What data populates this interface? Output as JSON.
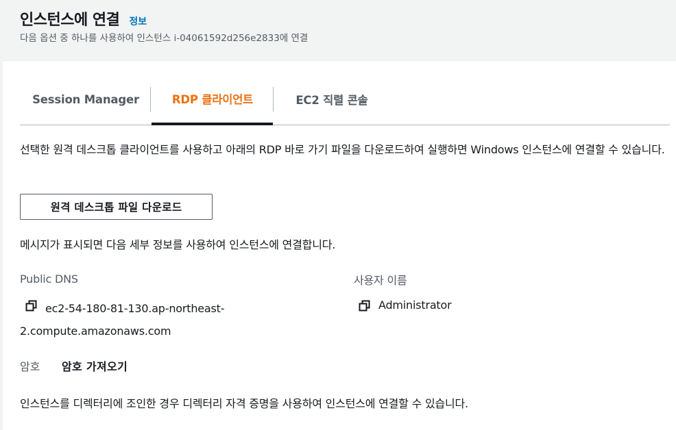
{
  "header": {
    "title": "인스턴스에 연결",
    "info_link": "정보",
    "subtitle": "다음 옵션 중 하나를 사용하여 인스턴스 i-04061592d256e2833에 연결"
  },
  "tabs": [
    {
      "label": "Session Manager",
      "active": false
    },
    {
      "label": "RDP 클라이언트",
      "active": true
    },
    {
      "label": "EC2 직렬 콘솔",
      "active": false
    }
  ],
  "rdp": {
    "description": "선택한 원격 데스크톱 클라이언트를 사용하고 아래의 RDP 바로 가기 파일을 다운로드하여 실행하면 Windows 인스턴스에 연결할 수 있습니다.",
    "download_button": "원격 데스크톱 파일 다운로드",
    "prompt_text": "메시지가 표시되면 다음 세부 정보를 사용하여 인스턴스에 연결합니다.",
    "public_dns_label": "Public DNS",
    "public_dns_value": "ec2-54-180-81-130.ap-northeast-2.compute.amazonaws.com",
    "username_label": "사용자 이름",
    "username_value": "Administrator",
    "password_label": "암호",
    "password_button": "암호 가져오기",
    "note": "인스턴스를 디렉터리에 조인한 경우 디렉터리 자격 증명을 사용하여 인스턴스에 연결할 수 있습니다."
  },
  "colors": {
    "accent": "#ec7211",
    "link": "#0073bb",
    "text": "#16191f",
    "secondary_text": "#545b64"
  }
}
